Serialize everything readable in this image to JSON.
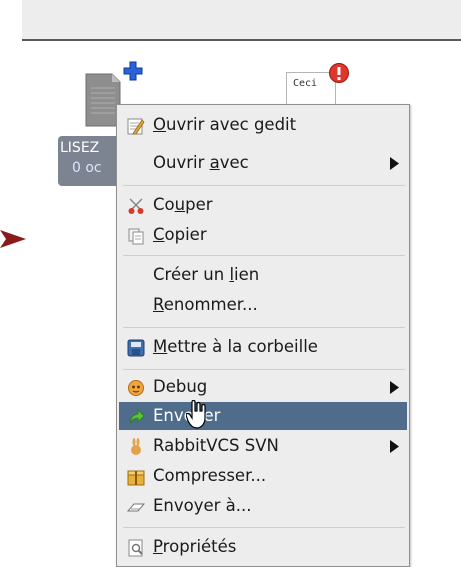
{
  "desktop": {
    "icons": [
      {
        "label": "LISEZ",
        "size": "0 oc",
        "emblem": "add-emblem"
      },
      {
        "preview_text": "Ceci",
        "emblem": "error-emblem"
      }
    ]
  },
  "context_menu": {
    "items": [
      {
        "label": "Ouvrir avec gedit",
        "mnemonic": "O",
        "icon": "gedit-icon",
        "has_submenu": false
      },
      {
        "label": "Ouvrir avec",
        "mnemonic": "a",
        "icon": "",
        "has_submenu": true
      },
      {
        "label": "Couper",
        "mnemonic": "u",
        "icon": "scissors-icon",
        "has_submenu": false
      },
      {
        "label": "Copier",
        "mnemonic": "C",
        "icon": "copy-icon",
        "has_submenu": false
      },
      {
        "label": "Créer un lien",
        "mnemonic": "l",
        "icon": "",
        "has_submenu": false
      },
      {
        "label": "Renommer...",
        "mnemonic": "R",
        "icon": "",
        "has_submenu": false
      },
      {
        "label": "Mettre à la corbeille",
        "mnemonic": "M",
        "icon": "trash-icon",
        "has_submenu": false
      },
      {
        "label": "Debug",
        "mnemonic": "",
        "icon": "debug-icon",
        "has_submenu": true
      },
      {
        "label": "Envoyer",
        "mnemonic": "",
        "icon": "send-icon",
        "has_submenu": false,
        "highlighted": true
      },
      {
        "label": "RabbitVCS SVN",
        "mnemonic": "",
        "icon": "rabbitvcs-icon",
        "has_submenu": true
      },
      {
        "label": "Compresser...",
        "mnemonic": "",
        "icon": "archive-icon",
        "has_submenu": false
      },
      {
        "label": "Envoyer à...",
        "mnemonic": "",
        "icon": "send-to-icon",
        "has_submenu": false
      },
      {
        "label": "Propriétés",
        "mnemonic": "P",
        "icon": "properties-icon",
        "has_submenu": false
      }
    ]
  },
  "colors": {
    "highlight": "#4f6d8b",
    "menu_background": "#ededed",
    "arrow_pointer": "#8b1a1a"
  }
}
